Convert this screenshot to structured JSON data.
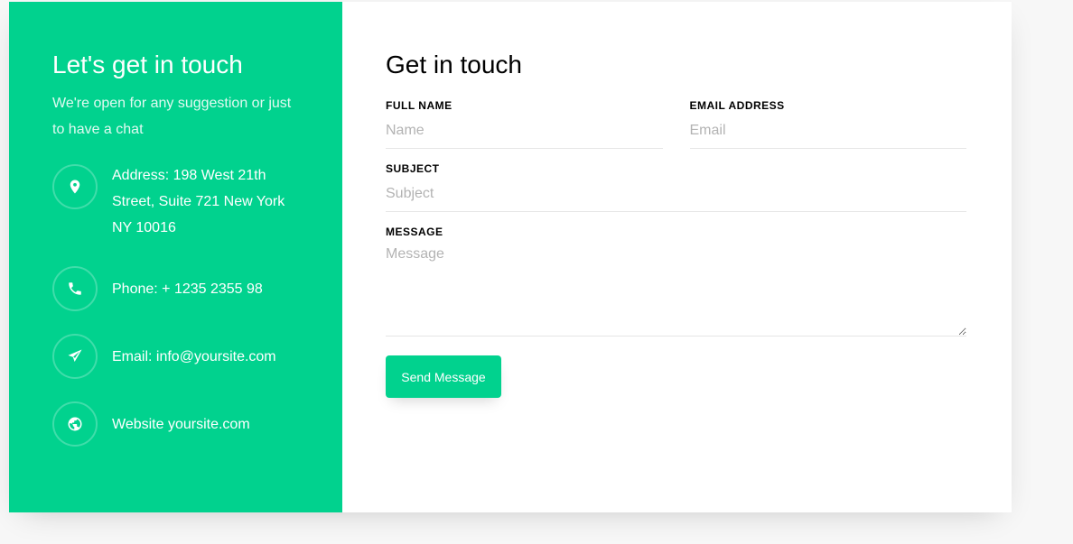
{
  "info": {
    "title": "Let's get in touch",
    "lead": "We're open for any suggestion or just to have a chat",
    "address": "Address: 198 West 21th Street, Suite 721 New York NY 10016",
    "phone": "Phone: + 1235 2355 98",
    "email": "Email: info@yoursite.com",
    "website": "Website yoursite.com",
    "icons": [
      "map-marker-icon",
      "phone-icon",
      "paper-plane-icon",
      "globe-icon"
    ]
  },
  "form": {
    "title": "Get in touch",
    "fullname_label": "FULL NAME",
    "fullname_placeholder": "Name",
    "email_label": "EMAIL ADDRESS",
    "email_placeholder": "Email",
    "subject_label": "SUBJECT",
    "subject_placeholder": "Subject",
    "message_label": "MESSAGE",
    "message_placeholder": "Message",
    "submit_label": "Send Message"
  },
  "colors": {
    "accent": "#01d28e",
    "background": "#f7f7f7"
  }
}
